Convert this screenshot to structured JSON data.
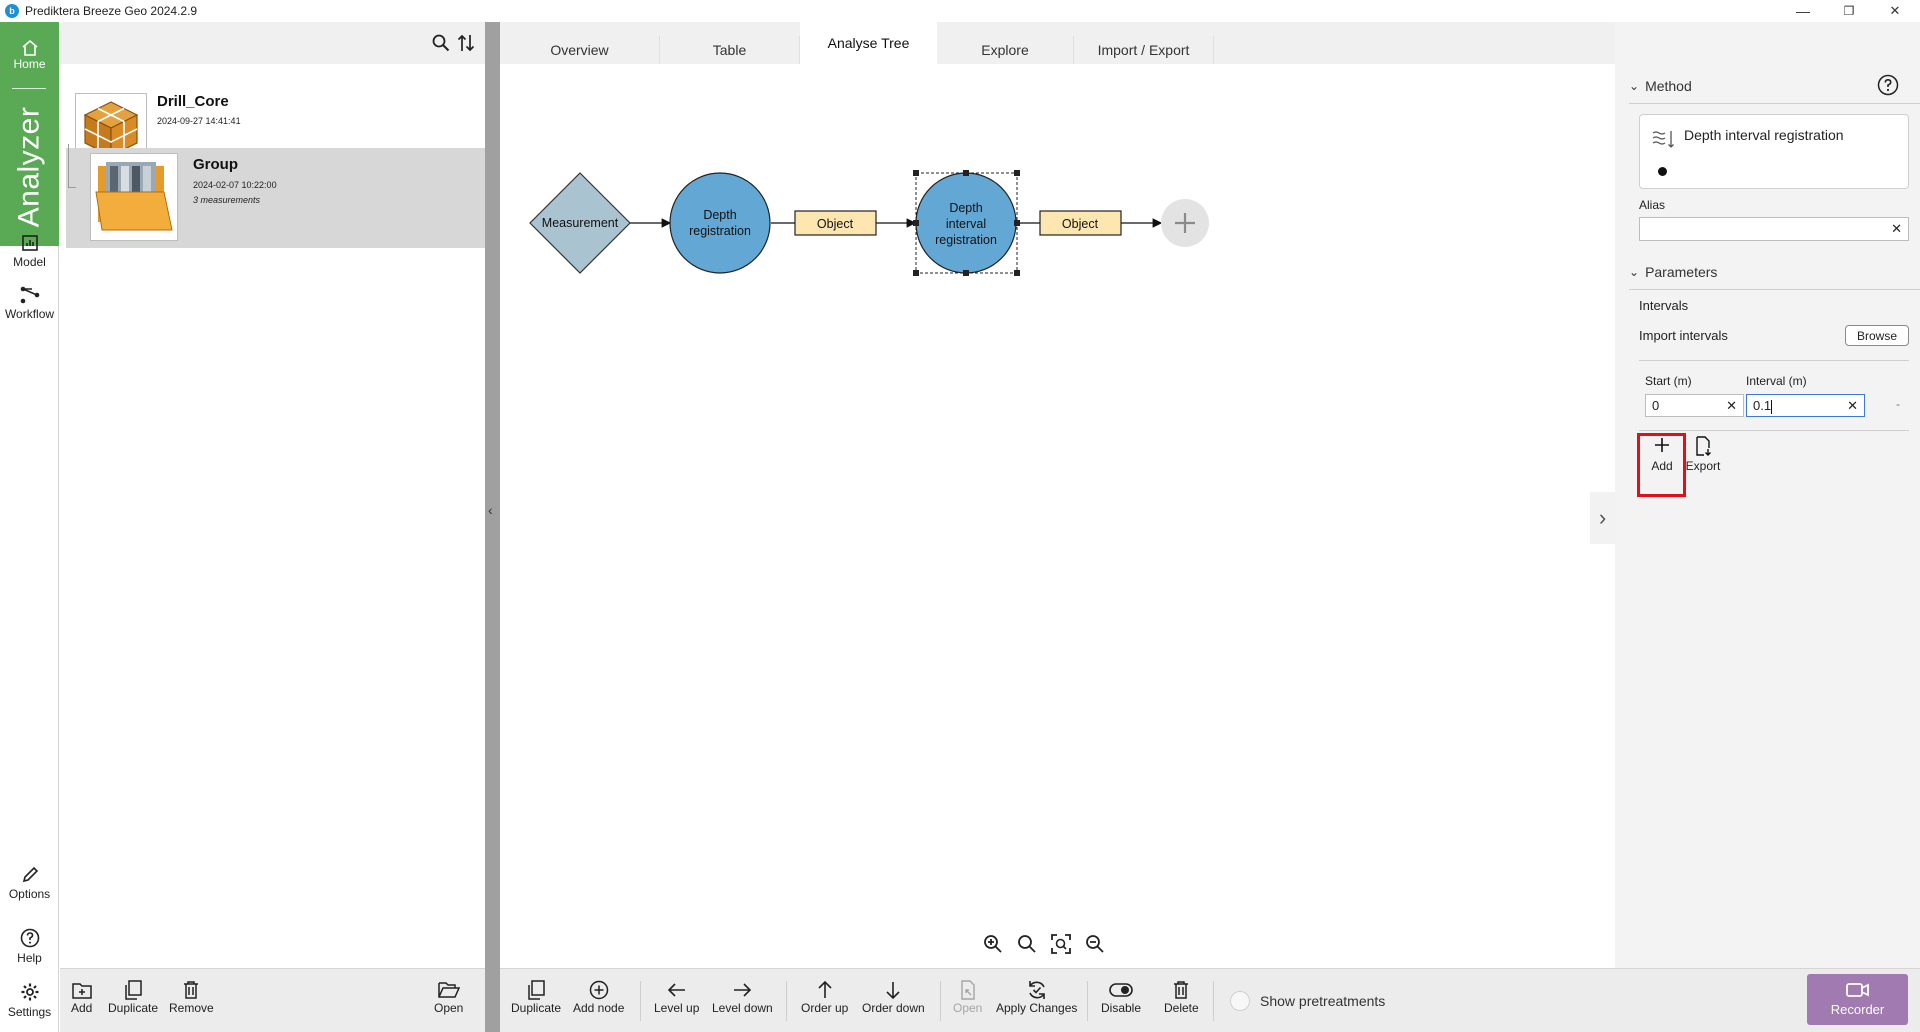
{
  "window": {
    "title": "Prediktera Breeze Geo 2024.2.9",
    "logo_letter": "b",
    "minimize": "—",
    "maximize": "❐",
    "close": "✕"
  },
  "nav": {
    "home": "Home",
    "analyzer": "Analyzer",
    "model": "Model",
    "workflow": "Workflow",
    "options": "Options",
    "help": "Help",
    "settings": "Settings"
  },
  "projects": [
    {
      "name": "Drill_Core",
      "date": "2024-09-27 14:41:41",
      "sub": ""
    },
    {
      "name": "Group",
      "date": "2024-02-07 10:22:00",
      "sub": "3 measurements"
    }
  ],
  "tabs": [
    "Overview",
    "Table",
    "Analyse Tree",
    "Explore",
    "Import / Export"
  ],
  "active_tab": "Analyse Tree",
  "tree": {
    "nodes": [
      "Measurement",
      "Depth registration",
      "Object",
      "Depth interval registration",
      "Object"
    ],
    "node_lines": {
      "measurement": "Measurement",
      "depth1": "Depth",
      "depth2": "registration",
      "object1": "Object",
      "interval1": "Depth",
      "interval2": "interval",
      "interval3": "registration",
      "object2": "Object"
    }
  },
  "right_panel": {
    "method_header": "Method",
    "method_name": "Depth interval registration",
    "alias_label": "Alias",
    "alias_value": "",
    "parameters_header": "Parameters",
    "intervals_label": "Intervals",
    "import_label": "Import intervals",
    "browse": "Browse",
    "start_label": "Start (m)",
    "start_value": "0",
    "interval_label": "Interval (m)",
    "interval_value": "0.1",
    "trailing_dash": "-",
    "add": "Add",
    "export": "Export"
  },
  "bottom_left": [
    "Add",
    "Duplicate",
    "Remove",
    "Open"
  ],
  "bottom_main": [
    "Duplicate",
    "Add node",
    "Level up",
    "Level down",
    "Order up",
    "Order down",
    "Open",
    "Apply Changes",
    "Disable",
    "Delete"
  ],
  "show_pretreatments": "Show pretreatments",
  "recorder": "Recorder",
  "colors": {
    "nav_green": "#5aaa55",
    "node_blue": "#63a8d4",
    "diamond": "#a9c3d1",
    "object_fill": "#fde6b0",
    "highlight_red": "#e0101a",
    "recorder_purple": "#a07ab0"
  }
}
